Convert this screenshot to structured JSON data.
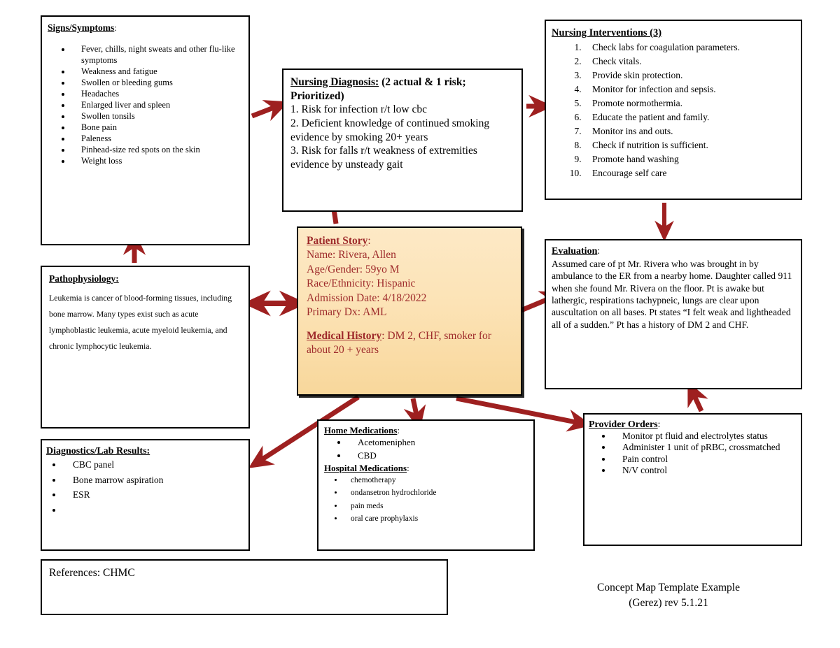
{
  "diagram": {
    "title": "Concept Map Template Example",
    "arrow_color": "#9e2020",
    "accent_box_color": "#9e2a2b",
    "boxes": {
      "signs_symptoms": {
        "header": "Signs/Symptoms",
        "header_suffix": ":",
        "items": [
          "Fever, chills, night sweats and other flu-like symptoms",
          "Weakness and fatigue",
          "Swollen or bleeding gums",
          "Headaches",
          "Enlarged liver and spleen",
          "Swollen tonsils",
          "Bone pain",
          "Paleness",
          "Pinhead-size red spots on the skin",
          "Weight loss"
        ]
      },
      "nursing_diagnosis": {
        "header": "Nursing Diagnosis:",
        "header_suffix": " (2 actual & 1 risk; Prioritized)",
        "lines": [
          "1. Risk for infection r/t low cbc",
          "2. Deficient knowledge of continued smoking evidence by smoking 20+ years",
          "3. Risk for falls r/t weakness of extremities evidence by unsteady gait"
        ]
      },
      "nursing_interventions": {
        "header": "Nursing Interventions (3)",
        "items": [
          "Check labs for coagulation parameters.",
          "Check vitals.",
          "Provide skin protection.",
          "Monitor for infection and sepsis.",
          "Promote normothermia.",
          "Educate the patient and family.",
          "Monitor ins and outs.",
          "Check if nutrition is sufficient.",
          "Promote hand washing",
          "Encourage self care"
        ]
      },
      "patient_story": {
        "header": "Patient Story",
        "header_suffix": ":",
        "lines": [
          "Name: Rivera, Allen",
          "Age/Gender: 59yo M",
          "Race/Ethnicity:  Hispanic",
          "Admission Date: 4/18/2022",
          "Primary Dx: AML"
        ],
        "history_header": "Medical History",
        "history_text": ": DM 2, CHF, smoker for about 20 + years"
      },
      "pathophysiology": {
        "header": "Pathophysiology: ",
        "body": "Leukemia is cancer of blood-forming tissues, including bone marrow. Many types exist such as acute lymphoblastic leukemia, acute myeloid leukemia, and chronic lymphocytic leukemia."
      },
      "evaluation": {
        "header": "Evaluation",
        "header_suffix": ":",
        "body": " Assumed care of pt Mr. Rivera who was brought in by ambulance to the ER from a nearby home. Daughter called 911 when she found Mr. Rivera on the floor. Pt is awake but lathergic, respirations tachypneic, lungs are clear upon auscultation on all bases. Pt states “I felt weak and lightheaded all of a sudden.” Pt has a history of DM 2 and CHF."
      },
      "provider_orders": {
        "header": "Provider Orders",
        "header_suffix": ":",
        "items": [
          "Monitor pt fluid and electrolytes status",
          "Administer 1 unit of pRBC, crossmatched",
          "Pain control",
          "N/V control"
        ]
      },
      "medications": {
        "home_header": "Home Medications",
        "home_header_suffix": ":",
        "home_items": [
          "Acetomeniphen",
          "CBD"
        ],
        "hospital_header": "Hospital Medications",
        "hospital_header_suffix": ":",
        "hospital_items": [
          "chemotherapy",
          "ondansetron hydrochloride",
          "pain meds",
          "oral care prophylaxis"
        ]
      },
      "diagnostics": {
        "header": "Diagnostics/Lab Results:",
        "items": [
          "CBC panel",
          "Bone marrow aspiration",
          "ESR",
          ""
        ]
      },
      "references": {
        "text": "References: CHMC"
      }
    },
    "footer": {
      "line1": "Concept Map Template Example",
      "line2": "(Gerez) rev 5.1.21"
    }
  }
}
